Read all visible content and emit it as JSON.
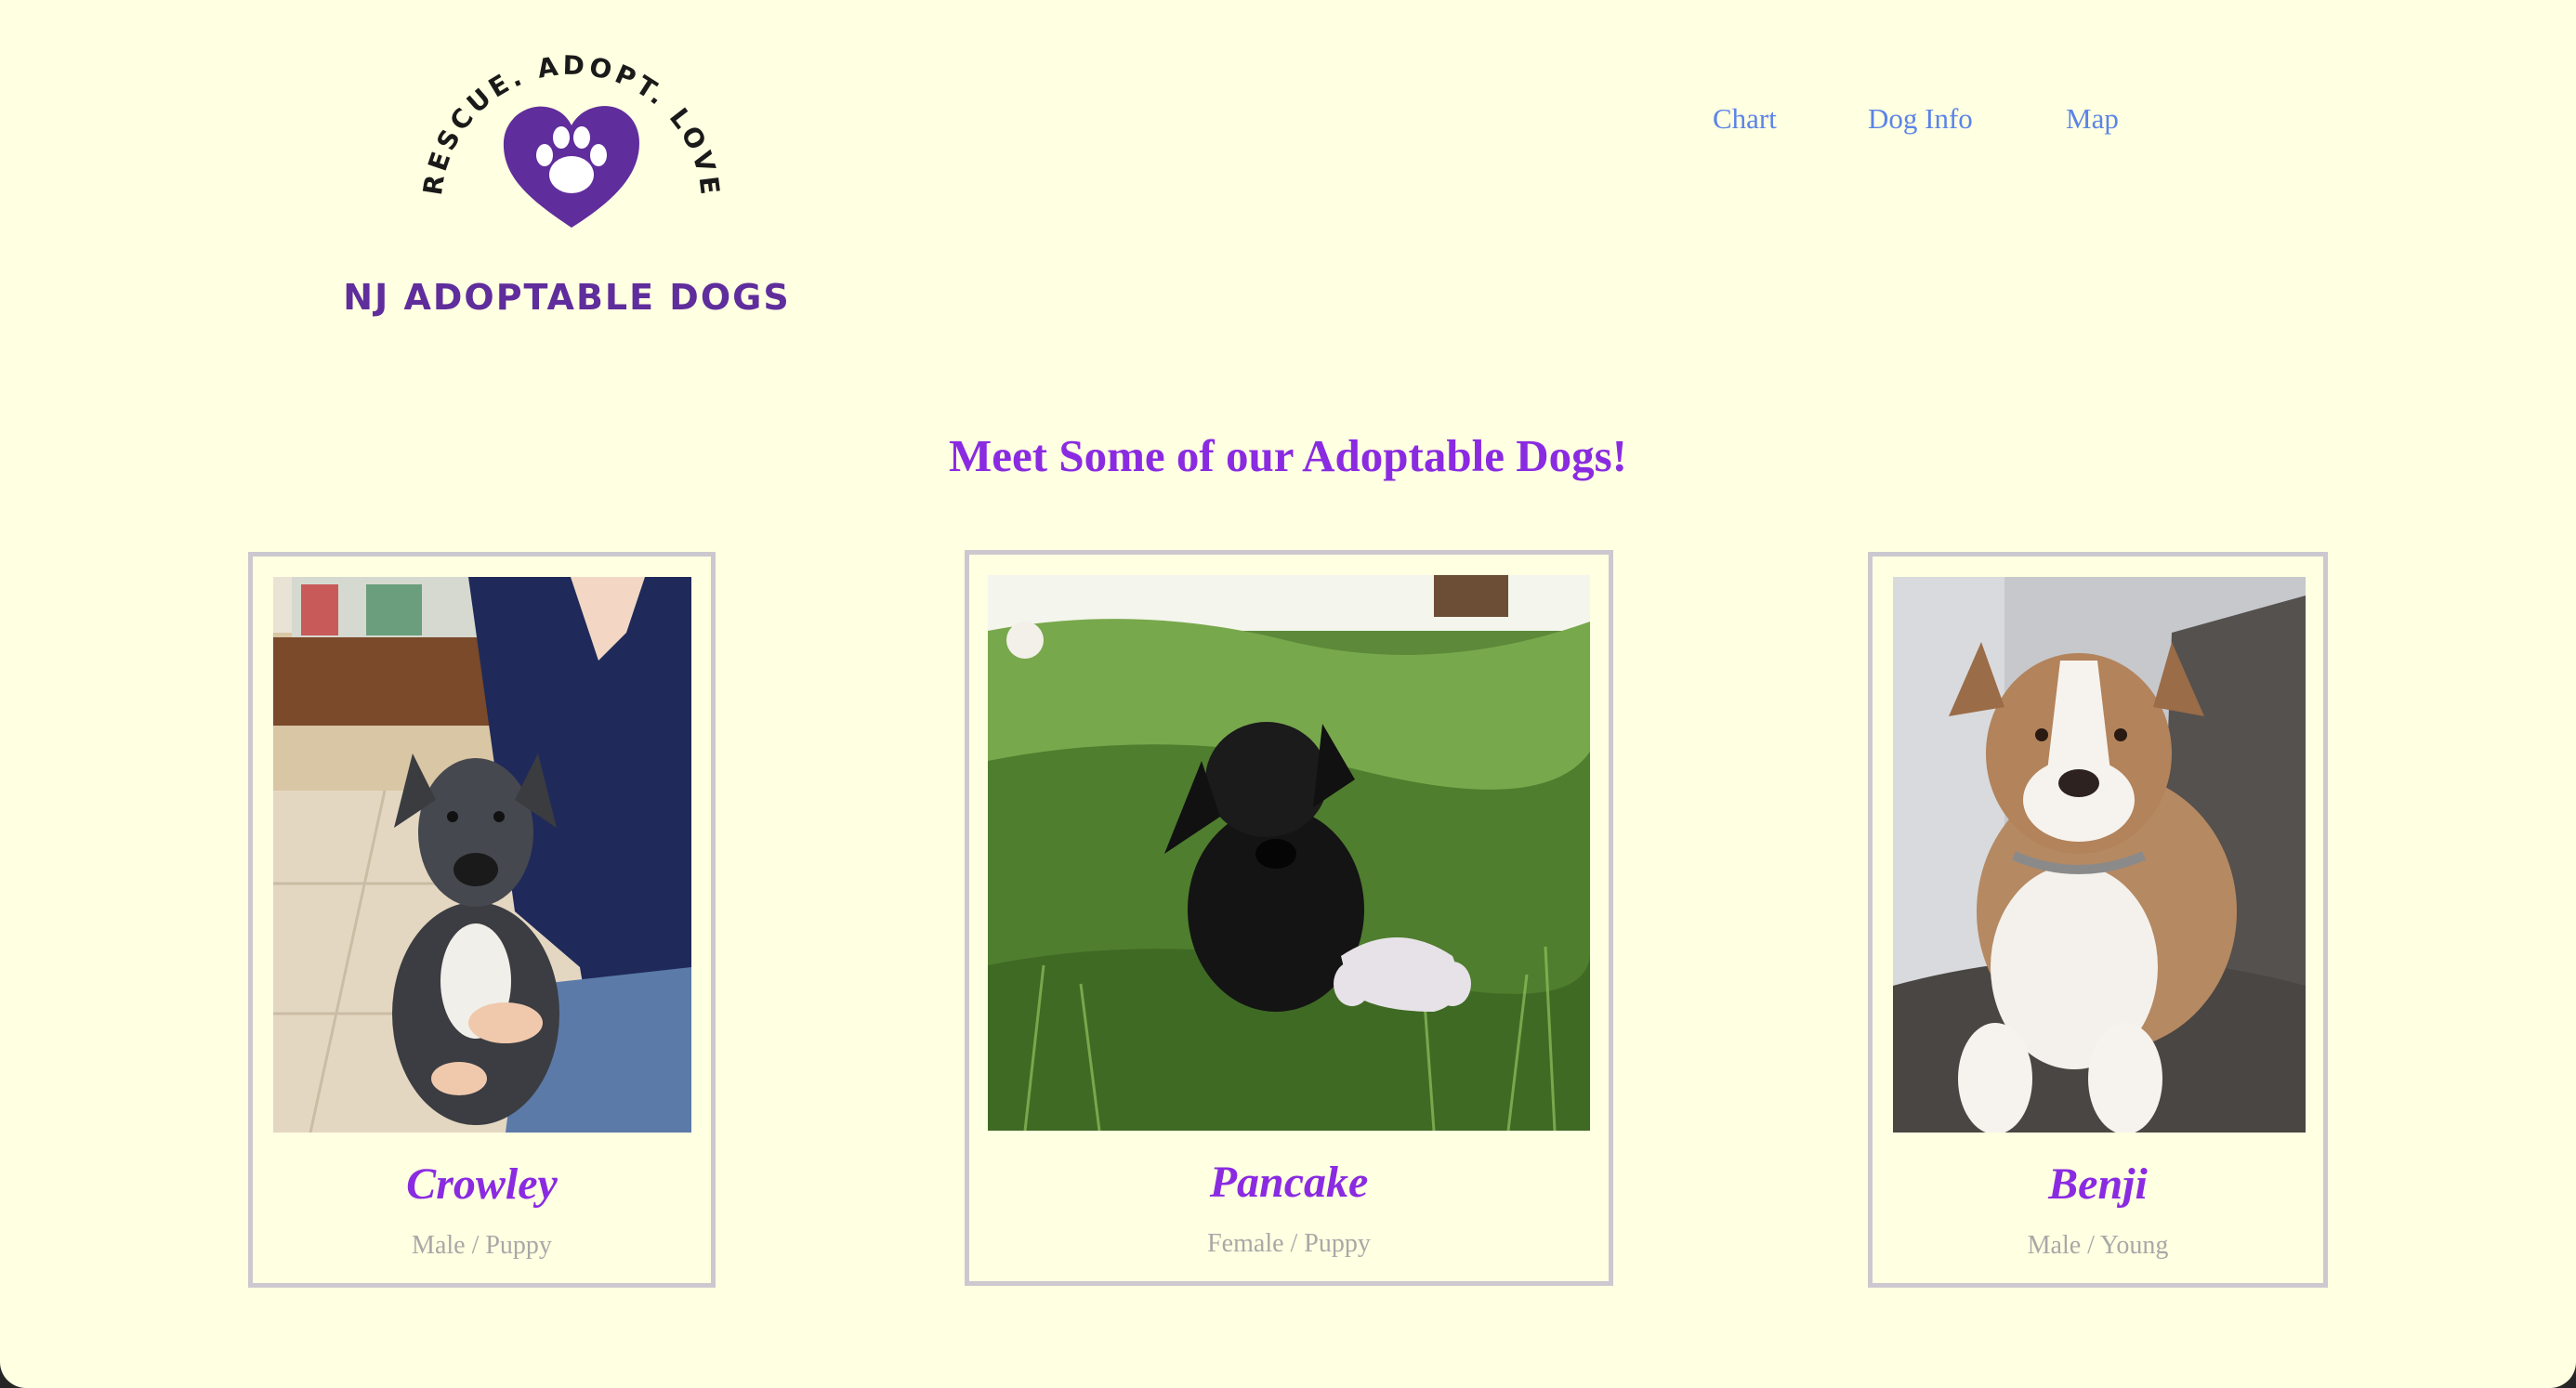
{
  "logo": {
    "arc_text": "RESCUE. ADOPT. LOVE FOR LIFE",
    "title": "NJ ADOPTABLE DOGS",
    "brand_color": "#5f2d9c",
    "icon": "heart-paw-icon"
  },
  "nav": {
    "items": [
      {
        "label": "Chart"
      },
      {
        "label": "Dog Info"
      },
      {
        "label": "Map"
      }
    ],
    "link_color": "#5b84e8"
  },
  "main": {
    "headline": "Meet Some of our Adoptable Dogs!",
    "accent_color": "#8a2be2",
    "dogs": [
      {
        "name": "Crowley",
        "details": "Male / Puppy"
      },
      {
        "name": "Pancake",
        "details": "Female / Puppy"
      },
      {
        "name": "Benji",
        "details": "Male / Young"
      }
    ]
  },
  "colors": {
    "background": "#ffffe1",
    "card_border": "#ccc8d0",
    "muted_text": "#a8a8a8"
  }
}
